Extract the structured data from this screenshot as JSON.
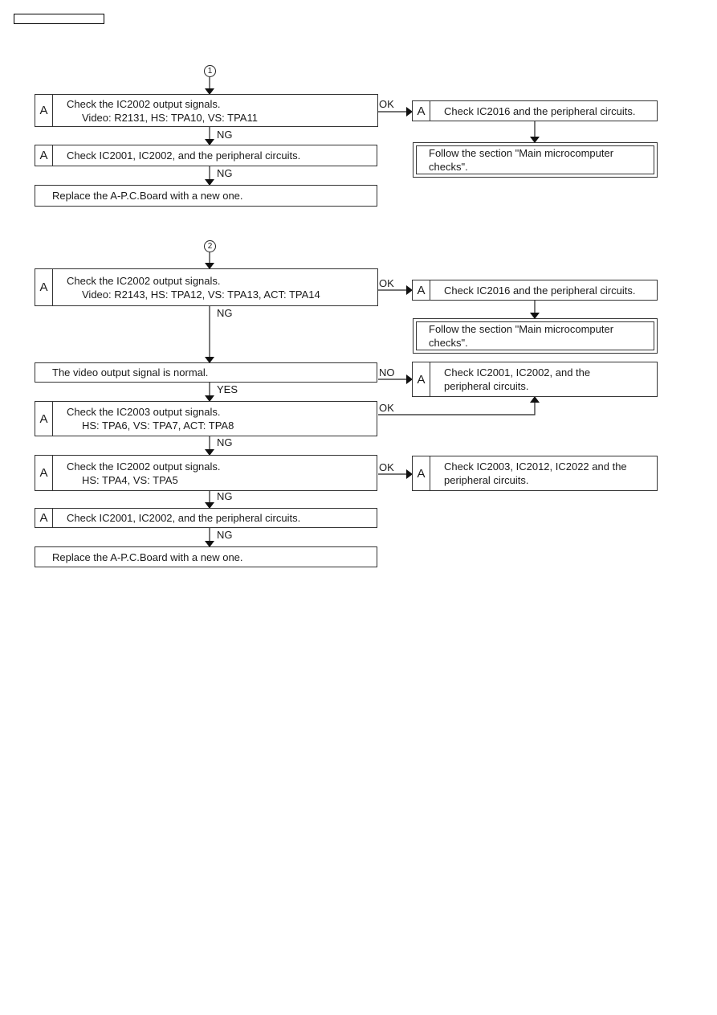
{
  "header_box": "",
  "flow1": {
    "start_marker": "1",
    "step1": {
      "tag": "A",
      "line1": "Check the IC2002 output signals.",
      "line2": "Video: R2131, HS: TPA10, VS: TPA11"
    },
    "step2": {
      "tag": "A",
      "line1": "Check IC2001, IC2002, and the peripheral circuits."
    },
    "step3": {
      "line1": "Replace the A-P.C.Board with a new one."
    },
    "ok_step": {
      "tag": "A",
      "line1": "Check IC2016 and the peripheral circuits."
    },
    "ok_follow": {
      "line1": "Follow the section \"Main microcomputer",
      "line2": "checks\"."
    },
    "labels": {
      "ok": "OK",
      "ng1": "NG",
      "ng2": "NG"
    }
  },
  "flow2": {
    "start_marker": "2",
    "step1": {
      "tag": "A",
      "line1": "Check the IC2002 output signals.",
      "line2": "Video: R2143, HS: TPA12, VS: TPA13, ACT: TPA14"
    },
    "ok_step": {
      "tag": "A",
      "line1": "Check IC2016 and the peripheral circuits."
    },
    "ok_follow": {
      "line1": "Follow the section \"Main microcomputer",
      "line2": "checks\"."
    },
    "decision": {
      "line1": "The video output signal is normal."
    },
    "no_step": {
      "tag": "A",
      "line1": "Check IC2001, IC2002, and the",
      "line2": "peripheral circuits."
    },
    "step3": {
      "tag": "A",
      "line1": "Check the IC2003 output signals.",
      "line2": "HS: TPA6, VS: TPA7, ACT: TPA8"
    },
    "step4": {
      "tag": "A",
      "line1": "Check the IC2002 output signals.",
      "line2": "HS: TPA4, VS: TPA5"
    },
    "step4_ok": {
      "tag": "A",
      "line1": "Check IC2003, IC2012, IC2022 and the",
      "line2": "peripheral circuits."
    },
    "step5": {
      "tag": "A",
      "line1": "Check IC2001, IC2002, and the peripheral circuits."
    },
    "step6": {
      "line1": "Replace the A-P.C.Board with a new one."
    },
    "labels": {
      "ok1": "OK",
      "ng1": "NG",
      "no": "NO",
      "yes": "YES",
      "ok2": "OK",
      "ng2": "NG",
      "ok3": "OK",
      "ng3": "NG",
      "ng4": "NG"
    }
  }
}
